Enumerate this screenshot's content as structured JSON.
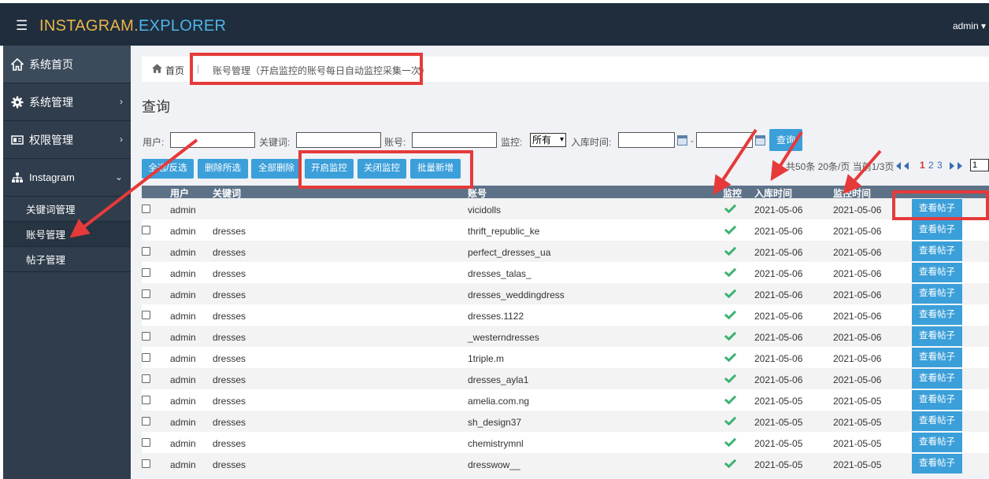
{
  "header": {
    "brand_part1": "INSTAGRAM.",
    "brand_part2": "EXPLORER",
    "user_label": "admin"
  },
  "sidebar": {
    "home": "系统首页",
    "system": "系统管理",
    "permission": "权限管理",
    "instagram": "Instagram",
    "sub_items": [
      "关键词管理",
      "账号管理",
      "帖子管理"
    ]
  },
  "breadcrumb": {
    "home": "首页",
    "current": "账号管理（开启监控的账号每日自动监控采集一次）"
  },
  "page_title": "查询",
  "filters": {
    "user_label": "用户:",
    "keyword_label": "关键词:",
    "account_label": "账号:",
    "monitor_label": "监控:",
    "monitor_value": "所有",
    "date_label": "入库时间:",
    "date_sep": "-",
    "query_label": "查询"
  },
  "actions": {
    "select_all": "全选/反选",
    "delete_selected": "删除所选",
    "delete_all": "全部删除",
    "enable_monitor": "开启监控",
    "disable_monitor": "关闭监控",
    "batch_add": "批量新增"
  },
  "pagination": {
    "summary": "共50条 20条/页 当前1/3页",
    "pages": [
      "1",
      "2",
      "3"
    ],
    "current_page": "1",
    "page_select": "1"
  },
  "table": {
    "headers": [
      "用户",
      "关键词",
      "账号",
      "监控",
      "入库时间",
      "监控时间"
    ],
    "view_label": "查看帖子",
    "rows": [
      {
        "user": "admin",
        "keyword": "",
        "account": "vicidolls",
        "in_date": "2021-05-06",
        "mon_date": "2021-05-06"
      },
      {
        "user": "admin",
        "keyword": "dresses",
        "account": "thrift_republic_ke",
        "in_date": "2021-05-06",
        "mon_date": "2021-05-06"
      },
      {
        "user": "admin",
        "keyword": "dresses",
        "account": "perfect_dresses_ua",
        "in_date": "2021-05-06",
        "mon_date": "2021-05-06"
      },
      {
        "user": "admin",
        "keyword": "dresses",
        "account": "dresses_talas_",
        "in_date": "2021-05-06",
        "mon_date": "2021-05-06"
      },
      {
        "user": "admin",
        "keyword": "dresses",
        "account": "dresses_weddingdress",
        "in_date": "2021-05-06",
        "mon_date": "2021-05-06"
      },
      {
        "user": "admin",
        "keyword": "dresses",
        "account": "dresses.1122",
        "in_date": "2021-05-06",
        "mon_date": "2021-05-06"
      },
      {
        "user": "admin",
        "keyword": "dresses",
        "account": "_westerndresses",
        "in_date": "2021-05-06",
        "mon_date": "2021-05-06"
      },
      {
        "user": "admin",
        "keyword": "dresses",
        "account": "1triple.m",
        "in_date": "2021-05-06",
        "mon_date": "2021-05-06"
      },
      {
        "user": "admin",
        "keyword": "dresses",
        "account": "dresses_ayla1",
        "in_date": "2021-05-06",
        "mon_date": "2021-05-06"
      },
      {
        "user": "admin",
        "keyword": "dresses",
        "account": "amelia.com.ng",
        "in_date": "2021-05-05",
        "mon_date": "2021-05-05"
      },
      {
        "user": "admin",
        "keyword": "dresses",
        "account": "sh_design37",
        "in_date": "2021-05-05",
        "mon_date": "2021-05-05"
      },
      {
        "user": "admin",
        "keyword": "dresses",
        "account": "chemistrymnl",
        "in_date": "2021-05-05",
        "mon_date": "2021-05-05"
      },
      {
        "user": "admin",
        "keyword": "dresses",
        "account": "dresswow__",
        "in_date": "2021-05-05",
        "mon_date": "2021-05-05"
      }
    ]
  },
  "colors": {
    "topbar": "#1f2d3d",
    "sidebar": "#2f3d4c",
    "accent": "#3b9fd9",
    "annotation": "#e63a3a",
    "check": "#3cb371"
  }
}
